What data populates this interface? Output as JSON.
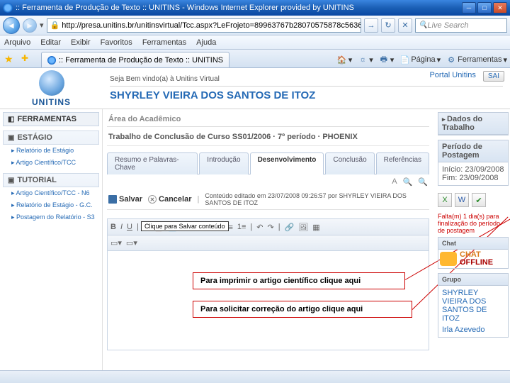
{
  "window": {
    "title": ":: Ferramenta de Produção de Texto :: UNITINS - Windows Internet Explorer provided by UNITINS",
    "url": "http://presa.unitins.br/unitinsvirtual/Tcc.aspx?LeFrojeto=89963767b28070575878c5636..942s9",
    "search_placeholder": "Live Search"
  },
  "menu": {
    "arquivo": "Arquivo",
    "editar": "Editar",
    "exibir": "Exibir",
    "favoritos": "Favoritos",
    "ferramentas": "Ferramentas",
    "ajuda": "Ajuda"
  },
  "tab": {
    "label": ":: Ferramenta de Produção de Texto :: UNITINS"
  },
  "ie_tools": {
    "pagina": "Página",
    "ferr": "Ferramentas"
  },
  "brand": "UNITINS",
  "welcome": "Seja Bem vindo(a) à Unitins Virtual",
  "user": "SHYRLEY VIEIRA DOS SANTOS DE ITOZ",
  "portal_link": "Portal Unitins",
  "sair": "SAI",
  "sidebar": {
    "head": "FERRAMENTAS",
    "g1": "ESTÁGIO",
    "i1": "Relatório de Estágio",
    "i2": "Artigo Científico/TCC",
    "g2": "TUTORIAL",
    "i3": "Artigo Científico/TCC - N6",
    "i4": "Relatório de Estágio - G.C.",
    "i5": "Postagem do Relatório - S3"
  },
  "main": {
    "area": "Área do Acadêmico",
    "trabalho": "Trabalho de Conclusão de Curso SS01/2006 · 7º período · PHOENIX",
    "tabs": {
      "t1": "Resumo e Palavras-Chave",
      "t2": "Introdução",
      "t3": "Desenvolvimento",
      "t4": "Conclusão",
      "t5": "Referências"
    },
    "font_a": "A",
    "salvar": "Salvar",
    "cancelar": "Cancelar",
    "edit_info": "Conteúdo editado em 23/07/2008 09:26:57 por SHYRLEY VIEIRA DOS SANTOS DE ITOZ",
    "save_tip": "Clique para Salvar conteúdo",
    "callout1": "Para imprimir o artigo científico clique aqui",
    "callout2": "Para solicitar correção do artigo clique aqui"
  },
  "right": {
    "dados": "Dados do Trabalho",
    "periodo": "Período de Postagem",
    "inicio": "Início: 23/09/2008",
    "fim": "Fim: 23/09/2008",
    "warn": "Falta(m) 1 dia(s) para finalização do período de postagem",
    "chat_h": "Chat",
    "chat1": "CHAT",
    "chat2": "OFFLINE",
    "grupo_h": "Grupo",
    "m1": "SHYRLEY VIEIRA DOS SANTOS DE ITOZ",
    "m2": "Irla Azevedo"
  },
  "rte": {
    "b": "B",
    "i": "I",
    "u": "U"
  }
}
